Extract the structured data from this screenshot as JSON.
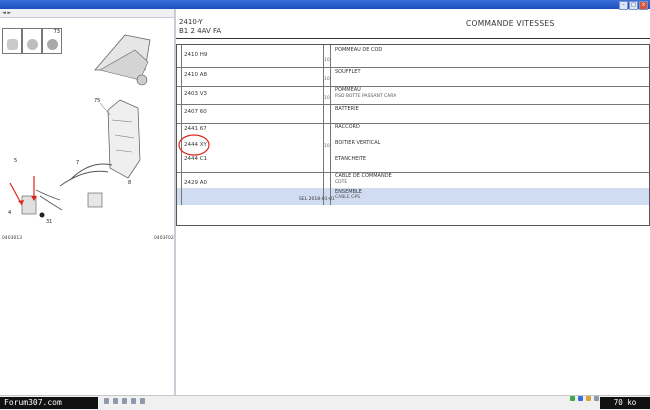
{
  "window": {
    "title": ""
  },
  "address_bar": {
    "url": ""
  },
  "diagram": {
    "thumb_labels": [
      "",
      "",
      "73"
    ],
    "callouts": [
      "75",
      "5",
      "8",
      "4",
      "31",
      "7"
    ],
    "bottom_codes": [
      "0403013",
      "0403F02"
    ]
  },
  "header": {
    "code": "2410-Y",
    "subtitle": "B1 2 4AV FA",
    "title": "COMMANDE VITESSES"
  },
  "parts": [
    {
      "ref": "10",
      "part": "2410 H9",
      "mid": "10",
      "desc": "POMMEAU DE COD",
      "sub": ""
    },
    {
      "ref": "",
      "part": "2410 A8",
      "mid": "10",
      "desc": "SOUFFLET",
      "sub": ""
    },
    {
      "ref": "",
      "part": "2403 V3",
      "mid": "10",
      "desc": "POMMEAU",
      "sub": "RSD BOTTE PASSANT CARA"
    },
    {
      "ref": "",
      "part": "2407 60",
      "mid": "",
      "desc": "BATTERIE",
      "sub": ""
    },
    {
      "ref": "",
      "part": "2441 67",
      "mid": "",
      "desc": "RACCORD",
      "sub": ""
    },
    {
      "ref": "",
      "part": "2444 XY",
      "mid": "10",
      "desc": "BOITIER VERTICAL",
      "sub": ""
    },
    {
      "ref": "",
      "part": "2444 C1",
      "mid": "",
      "desc": "ETANCHEITE",
      "sub": ""
    },
    {
      "ref": "",
      "part": "2429 A0",
      "mid": "",
      "desc": "CABLE DE COMMANDE",
      "sub": "CDTE"
    },
    {
      "ref": "",
      "part": "",
      "mid": "",
      "desc": "ENSEMBLE",
      "sub": "CABLE GPS"
    }
  ],
  "selected_annotation": "SEL 2018-01-01",
  "taskbar": {
    "forum": "Forum307.com",
    "size": "70 ko"
  },
  "colors": {
    "title_bar": "#1b4fbf",
    "selected_row": "#cfdcf2",
    "annotation": "#e0241a"
  }
}
